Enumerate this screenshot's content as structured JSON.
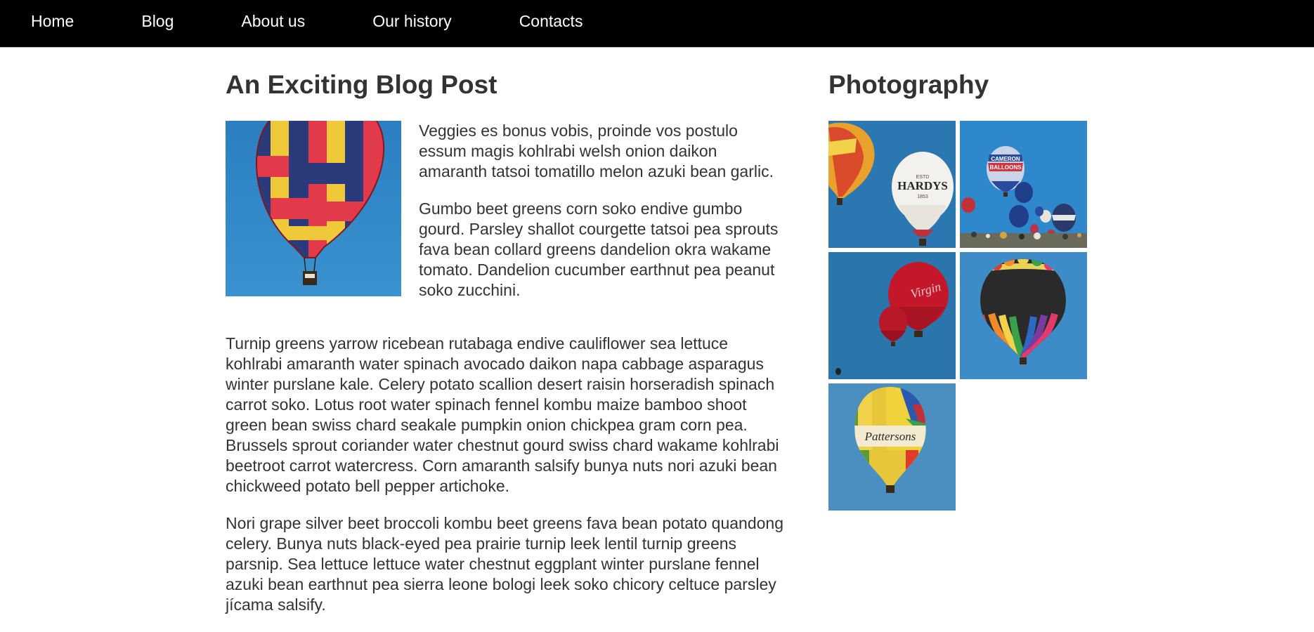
{
  "nav": {
    "items": [
      {
        "label": "Home"
      },
      {
        "label": "Blog"
      },
      {
        "label": "About us"
      },
      {
        "label": "Our history"
      },
      {
        "label": "Contacts"
      }
    ]
  },
  "article": {
    "title": "An Exciting Blog Post",
    "paragraphs": [
      "Veggies es bonus vobis, proinde vos postulo essum magis kohlrabi welsh onion daikon amaranth tatsoi tomatillo melon azuki bean garlic.",
      "Gumbo beet greens corn soko endive gumbo gourd. Parsley shallot courgette tatsoi pea sprouts fava bean collard greens dandelion okra wakame tomato. Dandelion cucumber earthnut pea peanut soko zucchini.",
      "Turnip greens yarrow ricebean rutabaga endive cauliflower sea lettuce kohlrabi amaranth water spinach avocado daikon napa cabbage asparagus winter purslane kale. Celery potato scallion desert raisin horseradish spinach carrot soko. Lotus root water spinach fennel kombu maize bamboo shoot green bean swiss chard seakale pumpkin onion chickpea gram corn pea. Brussels sprout coriander water chestnut gourd swiss chard wakame kohlrabi beetroot carrot watercress. Corn amaranth salsify bunya nuts nori azuki bean chickweed potato bell pepper artichoke.",
      "Nori grape silver beet broccoli kombu beet greens fava bean potato quandong celery. Bunya nuts black-eyed pea prairie turnip leek lentil turnip greens parsnip. Sea lettuce lettuce water chestnut eggplant winter purslane fennel azuki bean earthnut pea sierra leone bologi leek soko chicory celtuce parsley jícama salsify."
    ]
  },
  "sidebar": {
    "title": "Photography",
    "photo_text": {
      "hardys_brand": "HARDYS",
      "hardys_estd": "ESTD",
      "hardys_year": "1853",
      "cameron_line1": "CAMERON",
      "cameron_line2": "BALLOONS",
      "virgin_mark": "Virgin",
      "pattersons_brand": "Pattersons"
    }
  },
  "colors": {
    "nav_bg": "#000000",
    "nav_text": "#ffffff",
    "text": "#333333",
    "sky": "#2e86c1"
  }
}
